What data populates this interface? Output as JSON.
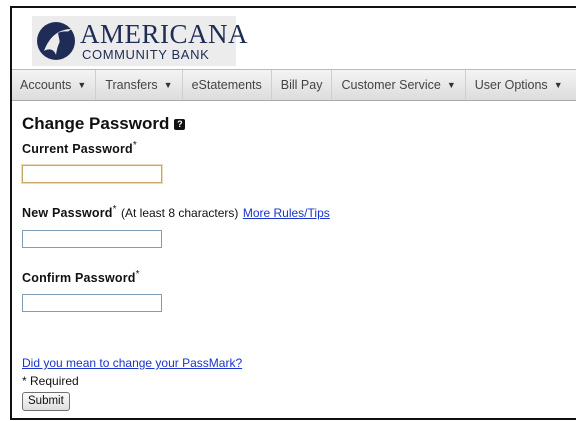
{
  "brand": {
    "name_line1": "AMERICANA",
    "name_line2": "COMMUNITY BANK",
    "colors": {
      "navy": "#1f2c56",
      "logo_bg": "#ececec"
    }
  },
  "nav": {
    "items": [
      {
        "label": "Accounts",
        "has_dropdown": true
      },
      {
        "label": "Transfers",
        "has_dropdown": true
      },
      {
        "label": "eStatements",
        "has_dropdown": false
      },
      {
        "label": "Bill Pay",
        "has_dropdown": false
      },
      {
        "label": "Customer Service",
        "has_dropdown": true
      },
      {
        "label": "User Options",
        "has_dropdown": true
      }
    ]
  },
  "form": {
    "title": "Change Password",
    "help_icon": "question-icon",
    "current_password": {
      "label": "Current Password",
      "required_mark": "*",
      "value": ""
    },
    "new_password": {
      "label": "New Password",
      "required_mark": "*",
      "note": "(At least 8 characters)",
      "link": "More Rules/Tips",
      "value": ""
    },
    "confirm_password": {
      "label": "Confirm Password",
      "required_mark": "*",
      "value": ""
    },
    "passmark_link": "Did you mean to change your PassMark?",
    "required_note": "* Required",
    "submit_label": "Submit"
  },
  "colors": {
    "link": "#1a35c8",
    "focus_border": "#c8a86a",
    "input_border": "#7f9db9"
  }
}
